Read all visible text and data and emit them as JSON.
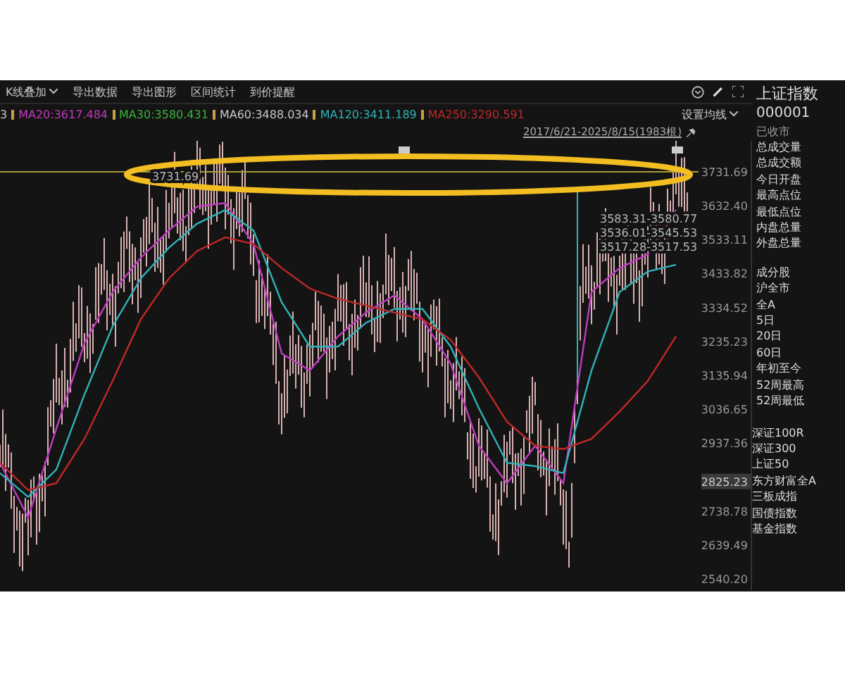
{
  "toolbar": {
    "menu": "K线叠加",
    "items": [
      "导出数据",
      "导出图形",
      "区间统计",
      "到价提醒"
    ]
  },
  "ma_legend": {
    "cut_value": "3",
    "items": [
      {
        "label": "MA20:3617.484",
        "color": "#c03bc0"
      },
      {
        "label": "MA30:3580.431",
        "color": "#3bb33b"
      },
      {
        "label": "MA60:3488.034",
        "color": "#c8c8c8"
      },
      {
        "label": "MA120:3411.189",
        "color": "#2fb3b8"
      },
      {
        "label": "MA250:3290.591",
        "color": "#c02828"
      }
    ],
    "settings": "设置均线"
  },
  "range": "2017/6/21-2025/8/15(1983根)",
  "chart": {
    "chart_data": {
      "type": "line",
      "ylim": [
        2540.2,
        3731.69
      ],
      "yticks": [
        {
          "value": 3731.69,
          "label": "3731.69"
        },
        {
          "value": 3632.4,
          "label": "3632.40"
        },
        {
          "value": 3533.11,
          "label": "3533.11"
        },
        {
          "value": 3433.82,
          "label": "3433.82"
        },
        {
          "value": 3334.52,
          "label": "3334.52"
        },
        {
          "value": 3235.23,
          "label": "3235.23"
        },
        {
          "value": 3135.94,
          "label": "3135.94"
        },
        {
          "value": 3036.65,
          "label": "3036.65"
        },
        {
          "value": 2937.36,
          "label": "2937.36"
        },
        {
          "value": 2738.78,
          "label": "2738.78"
        },
        {
          "value": 2639.49,
          "label": "2639.49"
        },
        {
          "value": 2540.2,
          "label": "2540.20"
        }
      ],
      "series": [
        {
          "color": "#c03bc0",
          "values": [
            2880,
            2720,
            2980,
            3230,
            3380,
            3480,
            3560,
            3630,
            3640,
            3520,
            3200,
            3150,
            3250,
            3320,
            3370,
            3300,
            3170,
            2930,
            2820,
            2930,
            2820,
            3380,
            3450,
            3490,
            3620
          ]
        },
        {
          "color": "#2fb3b8",
          "values": [
            2850,
            2780,
            2860,
            3080,
            3280,
            3420,
            3510,
            3580,
            3620,
            3560,
            3350,
            3220,
            3220,
            3290,
            3330,
            3330,
            3220,
            3040,
            2880,
            2870,
            2850,
            3150,
            3380,
            3440,
            3460
          ]
        },
        {
          "color": "#c02828",
          "values": [
            2880,
            2800,
            2820,
            2950,
            3120,
            3300,
            3420,
            3500,
            3540,
            3520,
            3450,
            3390,
            3360,
            3340,
            3320,
            3300,
            3240,
            3130,
            3000,
            2930,
            2920,
            2950,
            3030,
            3120,
            3250
          ]
        }
      ]
    },
    "high_label": "3731.69",
    "notes": [
      "3583.31-3580.77",
      "3536.01-3545.53",
      "3517.28-3517.53"
    ],
    "cursor_price": "2825.23"
  },
  "sidebar": {
    "title": "上证指数",
    "code": "000001",
    "status": "已收市",
    "stats": [
      "总成交量",
      "总成交额",
      "今日开盘",
      "最高点位",
      "最低点位",
      "内盘总量",
      "外盘总量"
    ],
    "periods": [
      "成分股",
      "沪全市",
      "全A",
      "5日",
      "20日",
      "60日",
      "年初至今",
      "52周最高",
      "52周最低"
    ],
    "indices": [
      "深证100R",
      "深证300",
      "上证50",
      "东方财富全A",
      "三板成指",
      "国债指数",
      "基金指数"
    ]
  }
}
